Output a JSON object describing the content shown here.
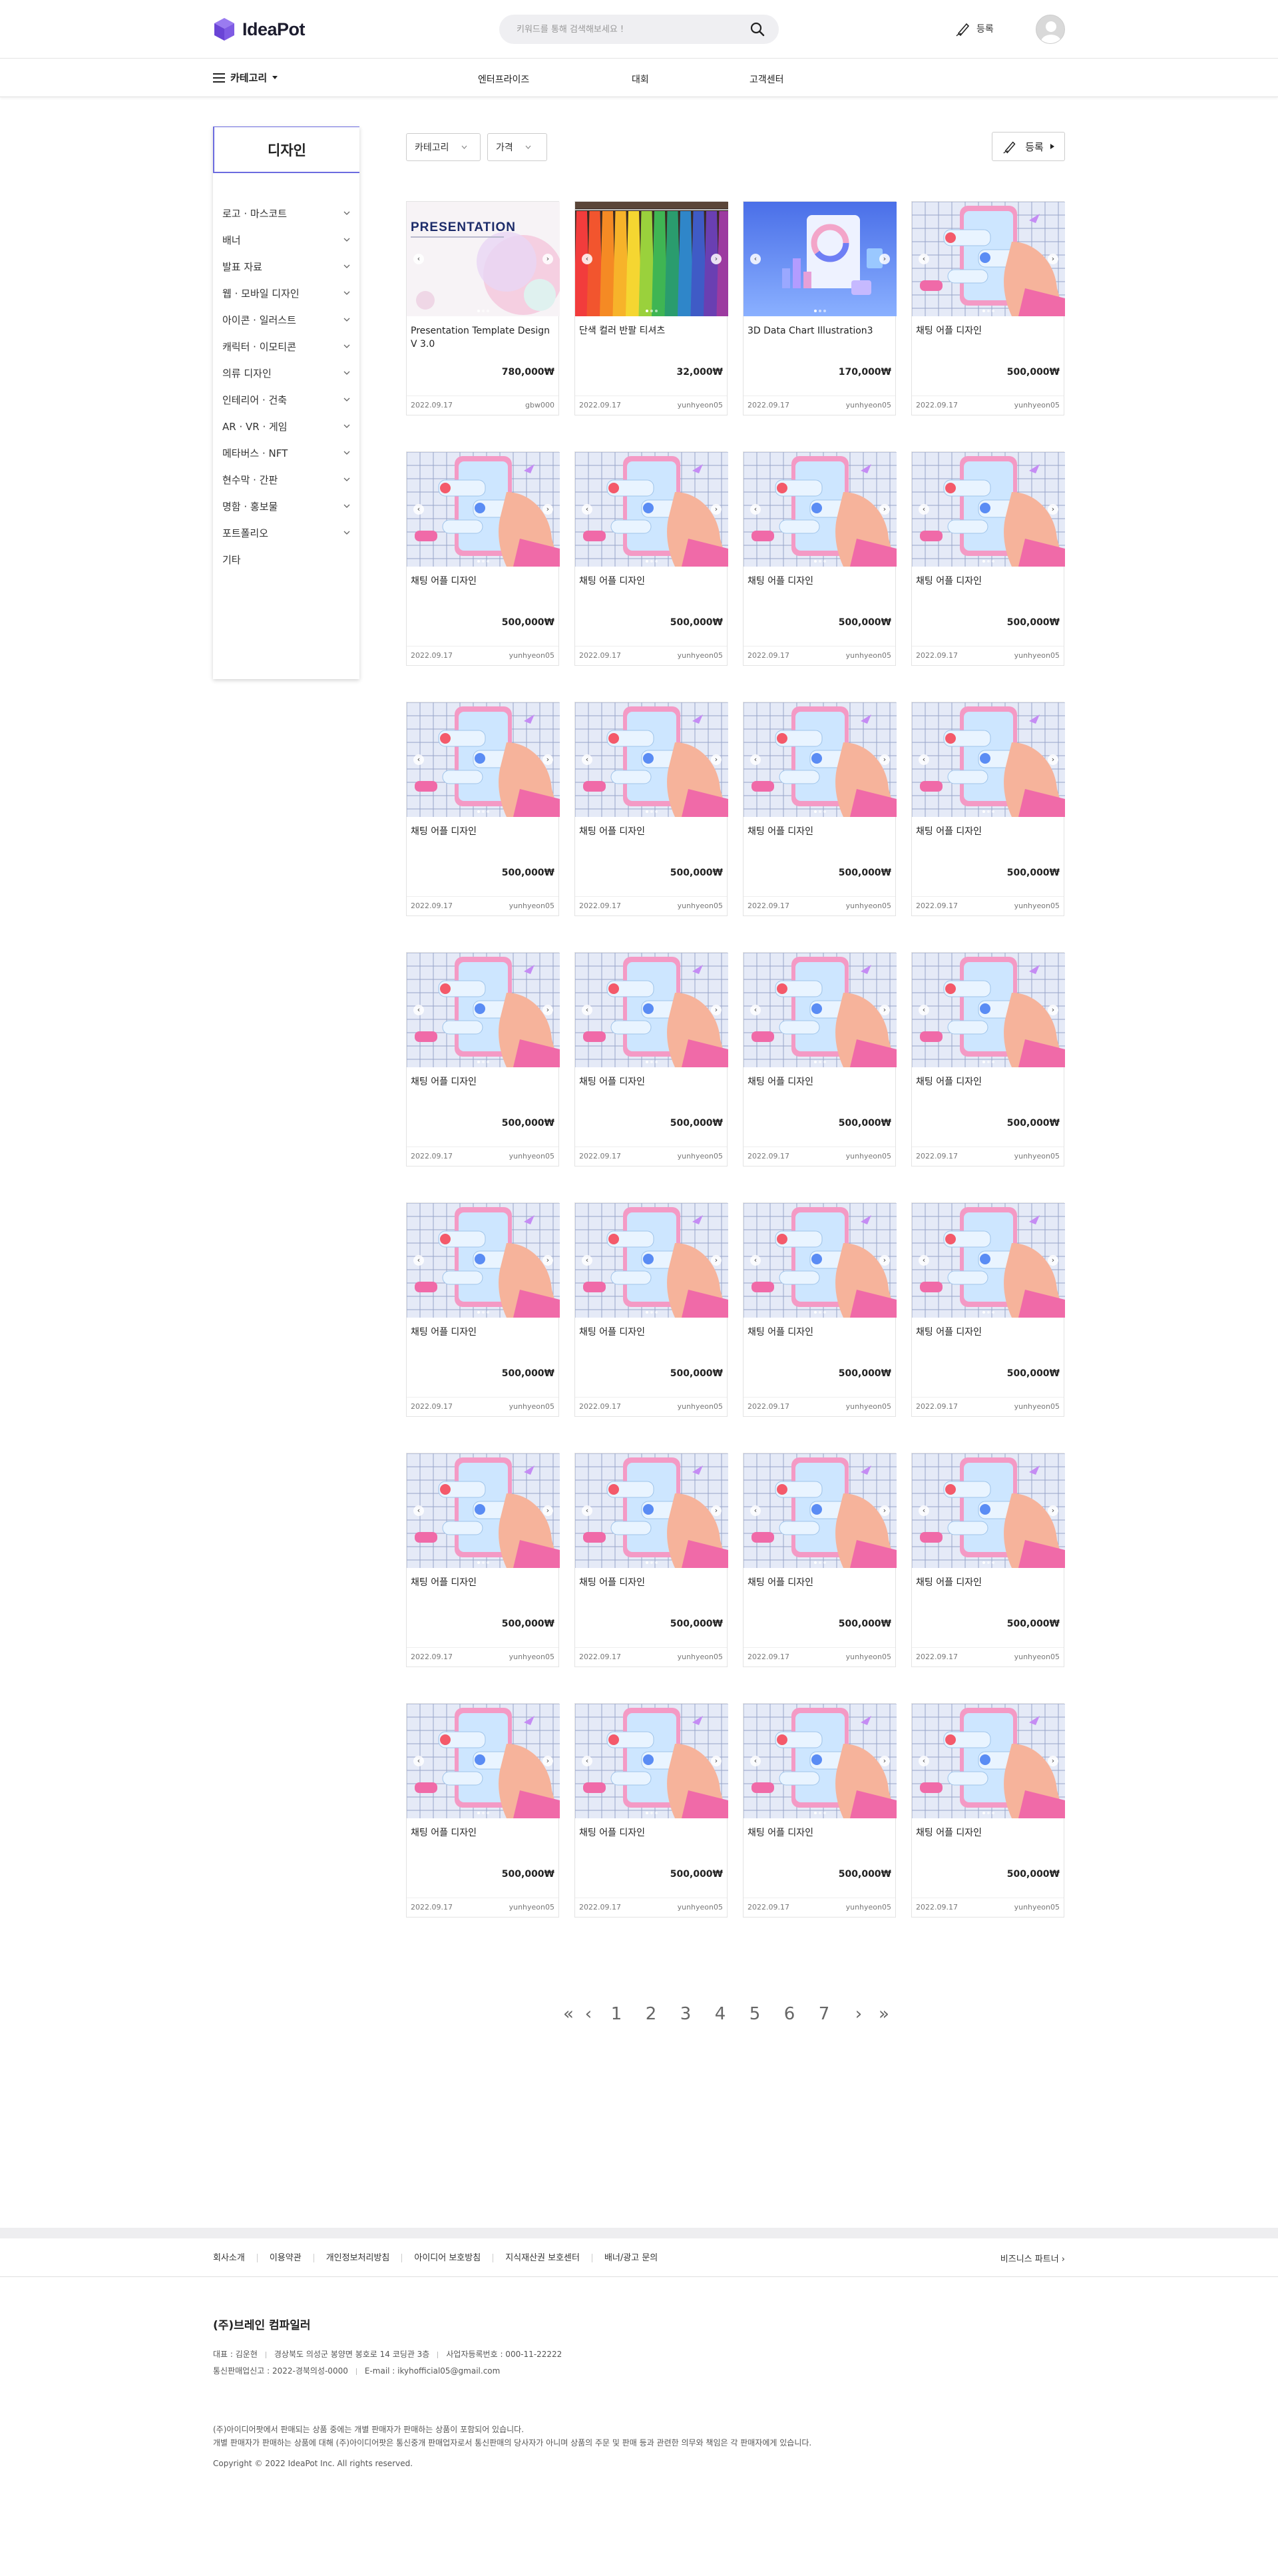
{
  "header": {
    "logo_text": "IdeaPot",
    "search_placeholder": "키워드를 통해 검색해보세요 !",
    "register_label": "등록"
  },
  "nav": {
    "category_label": "카테고리",
    "links": [
      "엔터프라이즈",
      "대회",
      "고객센터"
    ]
  },
  "sidebar": {
    "title": "디자인",
    "items": [
      {
        "label": "로고 · 마스코트",
        "expandable": true
      },
      {
        "label": "배너",
        "expandable": true
      },
      {
        "label": "발표 자료",
        "expandable": true
      },
      {
        "label": "웹 · 모바일 디자인",
        "expandable": true
      },
      {
        "label": "아이콘 · 일러스트",
        "expandable": true
      },
      {
        "label": "캐릭터 · 이모티콘",
        "expandable": true
      },
      {
        "label": "의류 디자인",
        "expandable": true
      },
      {
        "label": "인테리어 · 건축",
        "expandable": true
      },
      {
        "label": "AR · VR · 게임",
        "expandable": true
      },
      {
        "label": "메타버스 · NFT",
        "expandable": true
      },
      {
        "label": "현수막 · 간판",
        "expandable": true
      },
      {
        "label": "명함 · 홍보물",
        "expandable": true
      },
      {
        "label": "포트폴리오",
        "expandable": true
      },
      {
        "label": "기타",
        "expandable": false
      }
    ]
  },
  "filters": {
    "category": "카테고리",
    "price": "가격",
    "register": "등록"
  },
  "products": [
    {
      "title": "Presentation Template Design V 3.0",
      "price": "780,000₩",
      "date": "2022.09.17",
      "seller": "gbw000",
      "thumb": "presentation"
    },
    {
      "title": "단색 컬러 반팔 티셔츠",
      "price": "32,000₩",
      "date": "2022.09.17",
      "seller": "yunhyeon05",
      "thumb": "tshirt"
    },
    {
      "title": "3D Data Chart Illustration3",
      "price": "170,000₩",
      "date": "2022.09.17",
      "seller": "yunhyeon05",
      "thumb": "chart"
    },
    {
      "title": "채팅 어플 디자인",
      "price": "500,000₩",
      "date": "2022.09.17",
      "seller": "yunhyeon05",
      "thumb": "chat"
    },
    {
      "title": "채팅 어플 디자인",
      "price": "500,000₩",
      "date": "2022.09.17",
      "seller": "yunhyeon05",
      "thumb": "chat"
    },
    {
      "title": "채팅 어플 디자인",
      "price": "500,000₩",
      "date": "2022.09.17",
      "seller": "yunhyeon05",
      "thumb": "chat"
    },
    {
      "title": "채팅 어플 디자인",
      "price": "500,000₩",
      "date": "2022.09.17",
      "seller": "yunhyeon05",
      "thumb": "chat"
    },
    {
      "title": "채팅 어플 디자인",
      "price": "500,000₩",
      "date": "2022.09.17",
      "seller": "yunhyeon05",
      "thumb": "chat"
    },
    {
      "title": "채팅 어플 디자인",
      "price": "500,000₩",
      "date": "2022.09.17",
      "seller": "yunhyeon05",
      "thumb": "chat"
    },
    {
      "title": "채팅 어플 디자인",
      "price": "500,000₩",
      "date": "2022.09.17",
      "seller": "yunhyeon05",
      "thumb": "chat"
    },
    {
      "title": "채팅 어플 디자인",
      "price": "500,000₩",
      "date": "2022.09.17",
      "seller": "yunhyeon05",
      "thumb": "chat"
    },
    {
      "title": "채팅 어플 디자인",
      "price": "500,000₩",
      "date": "2022.09.17",
      "seller": "yunhyeon05",
      "thumb": "chat"
    },
    {
      "title": "채팅 어플 디자인",
      "price": "500,000₩",
      "date": "2022.09.17",
      "seller": "yunhyeon05",
      "thumb": "chat"
    },
    {
      "title": "채팅 어플 디자인",
      "price": "500,000₩",
      "date": "2022.09.17",
      "seller": "yunhyeon05",
      "thumb": "chat"
    },
    {
      "title": "채팅 어플 디자인",
      "price": "500,000₩",
      "date": "2022.09.17",
      "seller": "yunhyeon05",
      "thumb": "chat"
    },
    {
      "title": "채팅 어플 디자인",
      "price": "500,000₩",
      "date": "2022.09.17",
      "seller": "yunhyeon05",
      "thumb": "chat"
    },
    {
      "title": "채팅 어플 디자인",
      "price": "500,000₩",
      "date": "2022.09.17",
      "seller": "yunhyeon05",
      "thumb": "chat"
    },
    {
      "title": "채팅 어플 디자인",
      "price": "500,000₩",
      "date": "2022.09.17",
      "seller": "yunhyeon05",
      "thumb": "chat"
    },
    {
      "title": "채팅 어플 디자인",
      "price": "500,000₩",
      "date": "2022.09.17",
      "seller": "yunhyeon05",
      "thumb": "chat"
    },
    {
      "title": "채팅 어플 디자인",
      "price": "500,000₩",
      "date": "2022.09.17",
      "seller": "yunhyeon05",
      "thumb": "chat"
    },
    {
      "title": "채팅 어플 디자인",
      "price": "500,000₩",
      "date": "2022.09.17",
      "seller": "yunhyeon05",
      "thumb": "chat"
    },
    {
      "title": "채팅 어플 디자인",
      "price": "500,000₩",
      "date": "2022.09.17",
      "seller": "yunhyeon05",
      "thumb": "chat"
    },
    {
      "title": "채팅 어플 디자인",
      "price": "500,000₩",
      "date": "2022.09.17",
      "seller": "yunhyeon05",
      "thumb": "chat"
    },
    {
      "title": "채팅 어플 디자인",
      "price": "500,000₩",
      "date": "2022.09.17",
      "seller": "yunhyeon05",
      "thumb": "chat"
    },
    {
      "title": "채팅 어플 디자인",
      "price": "500,000₩",
      "date": "2022.09.17",
      "seller": "yunhyeon05",
      "thumb": "chat"
    },
    {
      "title": "채팅 어플 디자인",
      "price": "500,000₩",
      "date": "2022.09.17",
      "seller": "yunhyeon05",
      "thumb": "chat"
    },
    {
      "title": "채팅 어플 디자인",
      "price": "500,000₩",
      "date": "2022.09.17",
      "seller": "yunhyeon05",
      "thumb": "chat"
    },
    {
      "title": "채팅 어플 디자인",
      "price": "500,000₩",
      "date": "2022.09.17",
      "seller": "yunhyeon05",
      "thumb": "chat"
    }
  ],
  "pagination": {
    "first": "«",
    "prev": "‹",
    "pages": [
      "1",
      "2",
      "3",
      "4",
      "5",
      "6",
      "7"
    ],
    "next": "›",
    "last": "»"
  },
  "footer": {
    "links": [
      "회사소개",
      "이용약관",
      "개인정보처리방침",
      "아이디어 보호방침",
      "지식재산권 보호센터",
      "배너/광고 문의"
    ],
    "partner": "비즈니스 파트너",
    "company_name": "(주)브레인 컴파일러",
    "info_line1": [
      "대표 : 김운현",
      "경상북도 의성군 봉양면 봉호로 14 코딩관 3층",
      "사업자등록번호 : 000-11-22222"
    ],
    "info_line2": [
      "통신판매업신고 : 2022-경북의성-0000",
      "E-mail : ikyhofficial05@gmail.com"
    ],
    "notice1": "(주)아이디어팟에서 판매되는 상품 중에는 개별 판매자가 판매하는 상품이 포함되어 있습니다.",
    "notice2": "개별 판매자가 판매하는 상품에 대해 (주)아이디어팟은 통신중개 판매업자로서 통신판매의 당사자가 아니며 상품의 주문 및 판매 등과 관련한 의무와 책임은 각 판매자에게 있습니다.",
    "copyright": "Copyright © 2022 IdeaPot Inc. All rights reserved."
  },
  "colors": {
    "accent": "#6b6bdf",
    "logo": "#7b55e0"
  }
}
